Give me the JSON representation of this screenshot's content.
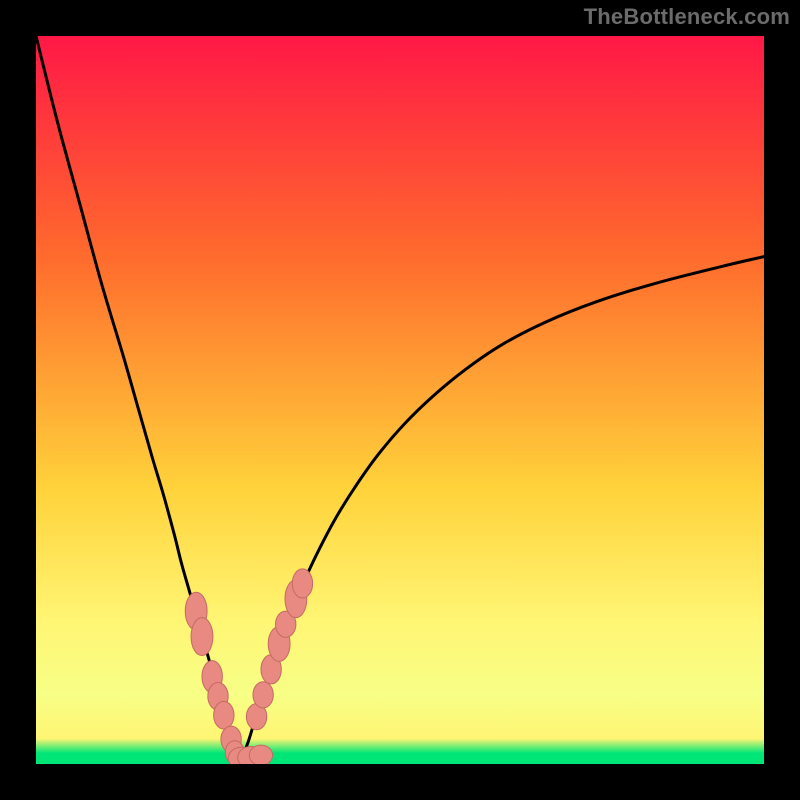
{
  "watermark": "TheBottleneck.com",
  "colors": {
    "bg": "#000000",
    "grad_top": "#ff1846",
    "grad_mid1": "#ff6a2d",
    "grad_mid2": "#ffd23a",
    "grad_low": "#fff573",
    "grad_band": "#f7ff86",
    "grad_bottom": "#00e676",
    "curve": "#000000",
    "dot_fill": "#e88a82",
    "dot_stroke": "#c46a63"
  },
  "chart_data": {
    "type": "line",
    "title": "",
    "xlabel": "",
    "ylabel": "",
    "xlim": [
      0,
      100
    ],
    "ylim": [
      0,
      100
    ],
    "series": [
      {
        "name": "left-branch",
        "x": [
          0,
          3,
          6,
          9,
          12,
          14,
          16,
          17.5,
          19,
          20,
          21,
          22,
          23,
          24,
          24.8,
          25.5,
          26.3,
          27,
          27.8
        ],
        "y": [
          100,
          88,
          77,
          66,
          56,
          49,
          42,
          37,
          31.5,
          27.5,
          24,
          20.5,
          17,
          13.5,
          10.5,
          7.5,
          5,
          2.6,
          0.8
        ]
      },
      {
        "name": "right-branch",
        "x": [
          28.3,
          29.2,
          30.2,
          31.3,
          32.5,
          33.8,
          35.3,
          37,
          39,
          41.3,
          44,
          47,
          50.5,
          54.5,
          59,
          64,
          70,
          77,
          85,
          94,
          100
        ],
        "y": [
          0.8,
          3.2,
          6.5,
          10,
          13.7,
          17.5,
          21.5,
          25.5,
          29.7,
          34,
          38.3,
          42.5,
          46.6,
          50.5,
          54.2,
          57.6,
          60.7,
          63.5,
          66,
          68.3,
          69.7
        ]
      },
      {
        "name": "bottom-link",
        "x": [
          27.8,
          28.0,
          28.3
        ],
        "y": [
          0.8,
          0.6,
          0.8
        ]
      }
    ],
    "dots": [
      {
        "x": 22.0,
        "y": 21.0,
        "rx": 1.5,
        "ry": 2.6
      },
      {
        "x": 22.8,
        "y": 17.5,
        "rx": 1.5,
        "ry": 2.6
      },
      {
        "x": 24.2,
        "y": 12.0,
        "rx": 1.4,
        "ry": 2.2
      },
      {
        "x": 25.0,
        "y": 9.3,
        "rx": 1.4,
        "ry": 1.9
      },
      {
        "x": 25.8,
        "y": 6.7,
        "rx": 1.4,
        "ry": 1.9
      },
      {
        "x": 26.8,
        "y": 3.4,
        "rx": 1.4,
        "ry": 1.8
      },
      {
        "x": 27.3,
        "y": 1.6,
        "rx": 1.3,
        "ry": 1.6
      },
      {
        "x": 28.2,
        "y": 0.8,
        "rx": 1.8,
        "ry": 1.5
      },
      {
        "x": 29.5,
        "y": 0.9,
        "rx": 1.8,
        "ry": 1.5
      },
      {
        "x": 30.9,
        "y": 1.2,
        "rx": 1.6,
        "ry": 1.4
      },
      {
        "x": 30.3,
        "y": 6.5,
        "rx": 1.4,
        "ry": 1.8
      },
      {
        "x": 31.2,
        "y": 9.5,
        "rx": 1.4,
        "ry": 1.8
      },
      {
        "x": 32.3,
        "y": 13.0,
        "rx": 1.4,
        "ry": 2.0
      },
      {
        "x": 33.4,
        "y": 16.5,
        "rx": 1.5,
        "ry": 2.4
      },
      {
        "x": 34.3,
        "y": 19.2,
        "rx": 1.4,
        "ry": 1.8
      },
      {
        "x": 35.7,
        "y": 22.7,
        "rx": 1.5,
        "ry": 2.6
      },
      {
        "x": 36.6,
        "y": 24.8,
        "rx": 1.4,
        "ry": 2.0
      }
    ],
    "gradient_stops": [
      {
        "offset": 0.0,
        "key": "grad_top"
      },
      {
        "offset": 0.3,
        "key": "grad_mid1"
      },
      {
        "offset": 0.62,
        "key": "grad_mid2"
      },
      {
        "offset": 0.8,
        "key": "grad_low"
      },
      {
        "offset": 0.905,
        "key": "grad_band"
      },
      {
        "offset": 0.965,
        "key": "grad_low"
      },
      {
        "offset": 0.985,
        "key": "grad_bottom"
      },
      {
        "offset": 1.0,
        "key": "grad_bottom"
      }
    ]
  }
}
